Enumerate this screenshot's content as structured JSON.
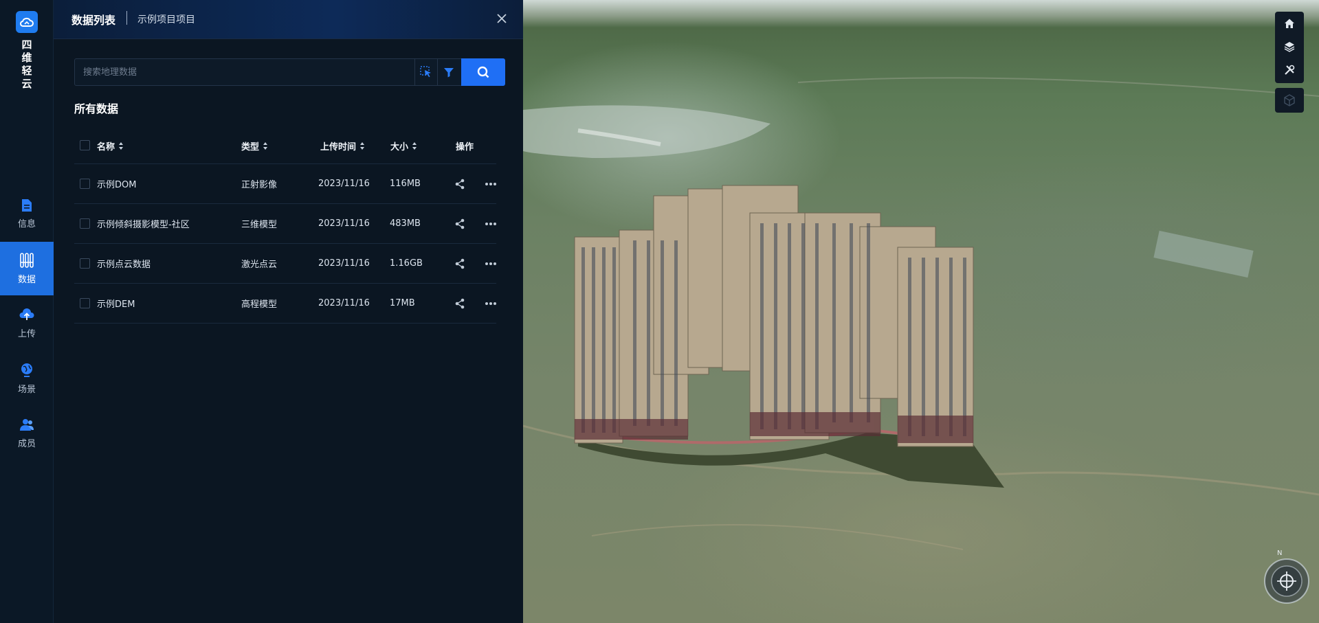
{
  "brand": {
    "name_chars": [
      "四",
      "维",
      "轻",
      "云"
    ]
  },
  "nav": {
    "items": [
      {
        "label": "信息",
        "icon": "document-icon",
        "active": false
      },
      {
        "label": "数据",
        "icon": "database-icon",
        "active": true
      },
      {
        "label": "上传",
        "icon": "upload-icon",
        "active": false
      },
      {
        "label": "场景",
        "icon": "globe-icon",
        "active": false
      },
      {
        "label": "成员",
        "icon": "members-icon",
        "active": false
      }
    ]
  },
  "panel": {
    "title": "数据列表",
    "project": "示例项目项目",
    "search_placeholder": "搜索地理数据",
    "section_title": "所有数据"
  },
  "table": {
    "headers": {
      "name": "名称",
      "type": "类型",
      "upload_time": "上传时间",
      "size": "大小",
      "actions": "操作"
    },
    "rows": [
      {
        "name": "示例DOM",
        "type": "正射影像",
        "upload_time": "2023/11/16",
        "size": "116MB"
      },
      {
        "name": "示例倾斜摄影模型-社区",
        "type": "三维模型",
        "upload_time": "2023/11/16",
        "size": "483MB"
      },
      {
        "name": "示例点云数据",
        "type": "激光点云",
        "upload_time": "2023/11/16",
        "size": "1.16GB"
      },
      {
        "name": "示例DEM",
        "type": "高程模型",
        "upload_time": "2023/11/16",
        "size": "17MB"
      }
    ]
  },
  "map": {
    "compass_label": "N",
    "tools": [
      "home-icon",
      "layers-icon",
      "tools-icon",
      "cube-3d-icon"
    ]
  },
  "colors": {
    "accent": "#1f6ff5",
    "rail_bg": "#0b1826",
    "panel_bg": "#0b1622"
  }
}
